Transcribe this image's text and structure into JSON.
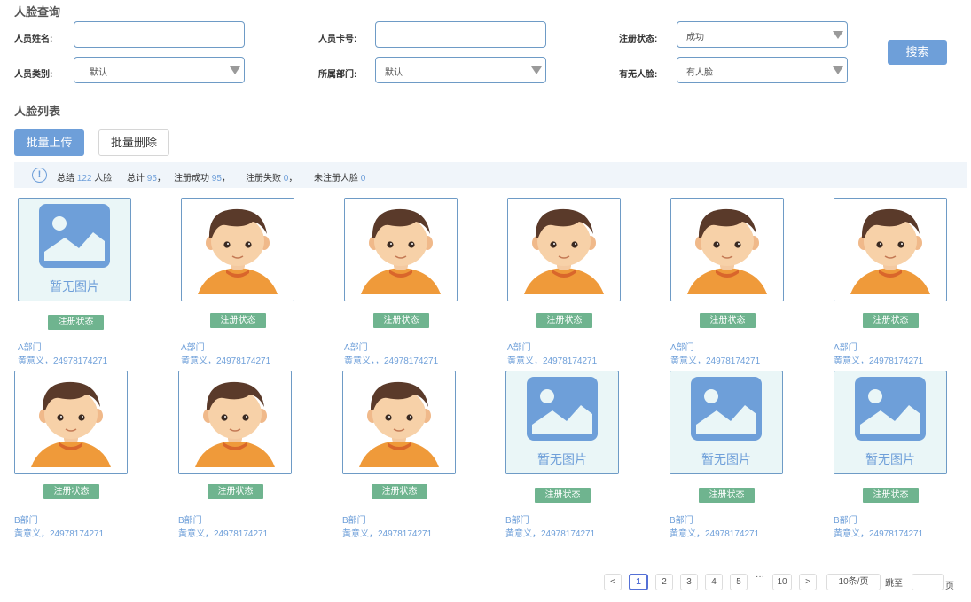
{
  "search": {
    "title": "人脸查询",
    "name_label": "人员姓名:",
    "name_value": "",
    "card_label": "人员卡号:",
    "card_value": "",
    "status_label": "注册状态:",
    "status_value": "成功",
    "type_label": "人员类别:",
    "type_value": "默认",
    "dept_label": "所属部门:",
    "dept_value": "默认",
    "face_label": "有无人脸:",
    "face_value": "有人脸",
    "search_button": "搜索"
  },
  "list": {
    "title": "人脸列表",
    "upload_button": "批量上传",
    "delete_button": "批量删除"
  },
  "summary": {
    "total_label": "总结",
    "total_value": "122",
    "total_unit": "人脸",
    "count_label": "总计",
    "count_value": "95",
    "success_label": "注册成功",
    "success_value": "95",
    "fail_label": "注册失败",
    "fail_value": "0",
    "unregistered_label": "未注册人脸",
    "unregistered_value": "0"
  },
  "empty_image_text": "暂无图片",
  "cards": [
    {
      "has_photo": false,
      "badge": "注册状态",
      "dept": "A部门",
      "person": "黄意义，24978174271"
    },
    {
      "has_photo": true,
      "badge": "注册状态",
      "dept": "A部门",
      "person": "黄意义，24978174271"
    },
    {
      "has_photo": true,
      "badge": "注册状态",
      "dept": "A部门",
      "person": "黄意义，，24978174271"
    },
    {
      "has_photo": true,
      "badge": "注册状态",
      "dept": "A部门",
      "person": "黄意义，24978174271"
    },
    {
      "has_photo": true,
      "badge": "注册状态",
      "dept": "A部门",
      "person": "黄意义，24978174271"
    },
    {
      "has_photo": true,
      "badge": "注册状态",
      "dept": "A部门",
      "person": "黄意义，24978174271"
    },
    {
      "has_photo": true,
      "badge": "注册状态",
      "dept": "B部门",
      "person": "黄意义，24978174271"
    },
    {
      "has_photo": true,
      "badge": "注册状态",
      "dept": "B部门",
      "person": "黄意义，24978174271"
    },
    {
      "has_photo": true,
      "badge": "注册状态",
      "dept": "B部门",
      "person": "黄意义，24978174271"
    },
    {
      "has_photo": false,
      "badge": "注册状态",
      "dept": "B部门",
      "person": "黄意义，24978174271"
    },
    {
      "has_photo": false,
      "badge": "注册状态",
      "dept": "B部门",
      "person": "黄意义，24978174271"
    },
    {
      "has_photo": false,
      "badge": "注册状态",
      "dept": "B部门",
      "person": "黄意义，24978174271"
    }
  ],
  "pagination": {
    "prev": "<",
    "pages": [
      "1",
      "2",
      "3",
      "4",
      "5"
    ],
    "ellipsis": "···",
    "last": "10",
    "next": ">",
    "active_page": "1",
    "page_size": "10条/页",
    "jump_label": "跳至",
    "jump_value": "",
    "page_unit": "页"
  },
  "colors": {
    "accent": "#6e9fd9",
    "badge": "#6fb48f",
    "border": "#6e9bc6",
    "shirt": "#ef9a3a",
    "hair": "#5a3a2a"
  }
}
